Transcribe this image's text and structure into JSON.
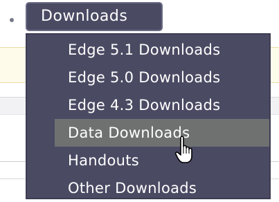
{
  "nav": {
    "button_label": "Downloads"
  },
  "menu": {
    "items": [
      {
        "label": "Edge 5.1 Downloads",
        "active": false
      },
      {
        "label": "Edge 5.0 Downloads",
        "active": false
      },
      {
        "label": "Edge 4.3 Downloads",
        "active": false
      },
      {
        "label": "Data Downloads",
        "active": true
      },
      {
        "label": "Handouts",
        "active": false
      },
      {
        "label": "Other Downloads",
        "active": false
      }
    ]
  },
  "colors": {
    "menu_bg": "#4a4a63",
    "menu_hover": "#6f7171",
    "text": "#ffffff"
  },
  "cursor": {
    "icon": "hand-pointer-icon"
  }
}
